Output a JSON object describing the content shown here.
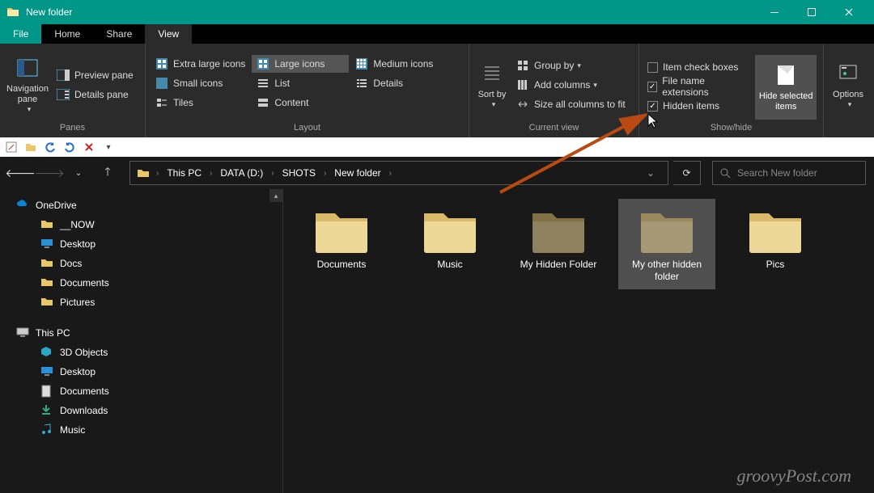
{
  "window": {
    "title": "New folder"
  },
  "tabs": {
    "file": "File",
    "home": "Home",
    "share": "Share",
    "view": "View"
  },
  "ribbon": {
    "panes": {
      "nav_pane": "Navigation pane",
      "preview": "Preview pane",
      "details": "Details pane",
      "group": "Panes"
    },
    "layout": {
      "xl": "Extra large icons",
      "large": "Large icons",
      "medium": "Medium icons",
      "small": "Small icons",
      "list": "List",
      "details": "Details",
      "tiles": "Tiles",
      "content": "Content",
      "group": "Layout"
    },
    "view": {
      "sort": "Sort by",
      "group_by": "Group by",
      "add_cols": "Add columns",
      "size_cols": "Size all columns to fit",
      "group": "Current view"
    },
    "showhide": {
      "check_boxes": "Item check boxes",
      "ext": "File name extensions",
      "hidden": "Hidden items",
      "hide_sel": "Hide selected items",
      "group": "Show/hide"
    },
    "options": "Options"
  },
  "breadcrumbs": [
    "This PC",
    "DATA (D:)",
    "SHOTS",
    "New folder"
  ],
  "search_placeholder": "Search New folder",
  "sidebar": {
    "onedrive": "OneDrive",
    "now": "__NOW",
    "desktop": "Desktop",
    "docs": "Docs",
    "documents": "Documents",
    "pictures": "Pictures",
    "thispc": "This PC",
    "threeD": "3D Objects",
    "desktop2": "Desktop",
    "documents2": "Documents",
    "downloads": "Downloads",
    "music": "Music"
  },
  "folders": [
    {
      "name": "Documents",
      "hidden": false,
      "selected": false
    },
    {
      "name": "Music",
      "hidden": false,
      "selected": false
    },
    {
      "name": "My Hidden Folder",
      "hidden": true,
      "selected": false
    },
    {
      "name": "My other hidden folder",
      "hidden": true,
      "selected": true
    },
    {
      "name": "Pics",
      "hidden": false,
      "selected": false
    }
  ],
  "watermark": "groovyPost.com"
}
